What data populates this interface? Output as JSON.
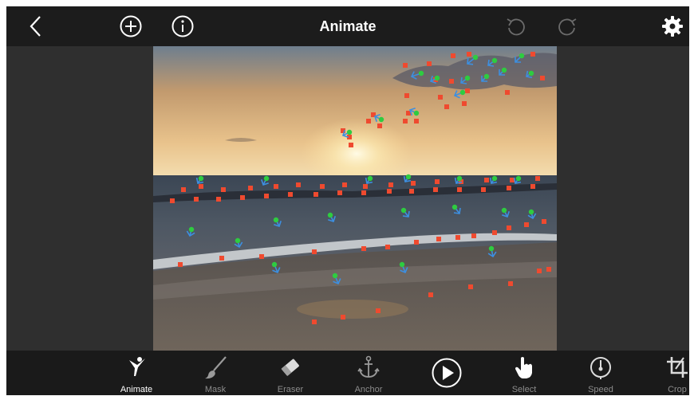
{
  "header": {
    "title": "Animate"
  },
  "toolbar": {
    "tools": [
      {
        "label": "Animate",
        "icon": "dancer-icon",
        "active": true
      },
      {
        "label": "Mask",
        "icon": "brush-icon",
        "active": false
      },
      {
        "label": "Eraser",
        "icon": "eraser-icon",
        "active": false
      },
      {
        "label": "Anchor",
        "icon": "anchor-icon",
        "active": false
      },
      {
        "label": "",
        "icon": "play-icon",
        "active": false
      },
      {
        "label": "Select",
        "icon": "hand-pointer-icon",
        "active": false
      },
      {
        "label": "Speed",
        "icon": "speedometer-icon",
        "active": false
      },
      {
        "label": "Crop",
        "icon": "crop-icon",
        "active": false
      }
    ]
  },
  "colors": {
    "anchor_point": "#ef4a2f",
    "motion_start": "#2ecc40",
    "motion_arrow": "#3d8fe0",
    "active_label": "#ffffff",
    "inactive_label": "#8c8c8c"
  }
}
